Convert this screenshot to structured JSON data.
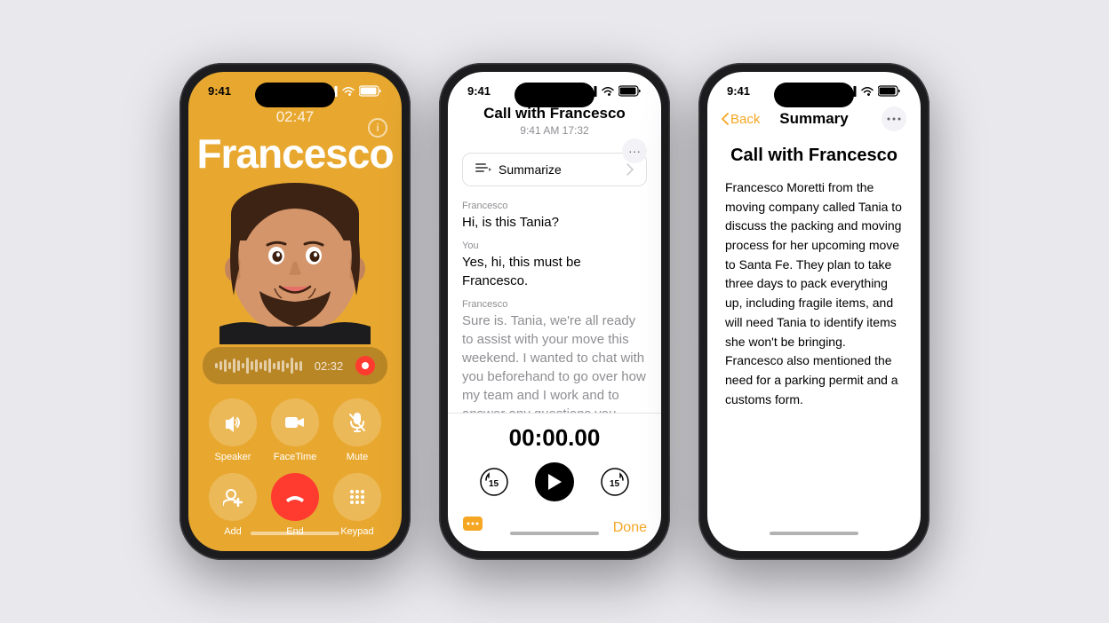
{
  "phone1": {
    "statusBar": {
      "time": "9:41",
      "signal": "▪▪▪",
      "wifi": "wifi",
      "battery": "battery"
    },
    "callTimer": "02:47",
    "callerName": "Francesco",
    "recordingTime": "02:32",
    "controls": {
      "row1": [
        {
          "id": "speaker",
          "icon": "🔊",
          "label": "Speaker"
        },
        {
          "id": "facetime",
          "icon": "📹",
          "label": "FaceTime"
        },
        {
          "id": "mute",
          "icon": "🎤",
          "label": "Mute"
        }
      ],
      "row2": [
        {
          "id": "add",
          "icon": "👤",
          "label": "Add"
        },
        {
          "id": "end",
          "icon": "📞",
          "label": "End"
        },
        {
          "id": "keypad",
          "icon": "⊞",
          "label": "Keypad"
        }
      ]
    }
  },
  "phone2": {
    "statusBar": {
      "time": "9:41"
    },
    "header": {
      "title": "Call with Francesco",
      "subtitle": "9:41 AM  17:32",
      "moreIcon": "···"
    },
    "summarizeLabel": "Summarize",
    "transcript": [
      {
        "speaker": "Francesco",
        "text": "Hi, is this Tania?",
        "faded": false
      },
      {
        "speaker": "You",
        "text": "Yes, hi, this must be Francesco.",
        "faded": false
      },
      {
        "speaker": "Francesco",
        "text": "Sure is. Tania, we're all ready to assist with your move this weekend. I wanted to chat with you beforehand to go over how my team and I work and to answer any questions you might have before we arrive Saturday",
        "faded": true
      }
    ],
    "playback": {
      "timer": "00:00.00",
      "skipBack": "⏮",
      "play": "▶",
      "skipForward": "⏭"
    },
    "footer": {
      "chatIcon": "💬",
      "doneLabel": "Done"
    }
  },
  "phone3": {
    "statusBar": {
      "time": "9:41"
    },
    "nav": {
      "backLabel": "Back",
      "title": "Summary",
      "moreIcon": "···"
    },
    "summary": {
      "title": "Call with Francesco",
      "body": "Francesco Moretti from the moving company called Tania to discuss the packing and moving process for her upcoming move to Santa Fe. They plan to take three days to pack everything up, including fragile items, and will need Tania to identify items she won't be bringing. Francesco also mentioned the need for a parking permit and a customs form."
    }
  }
}
